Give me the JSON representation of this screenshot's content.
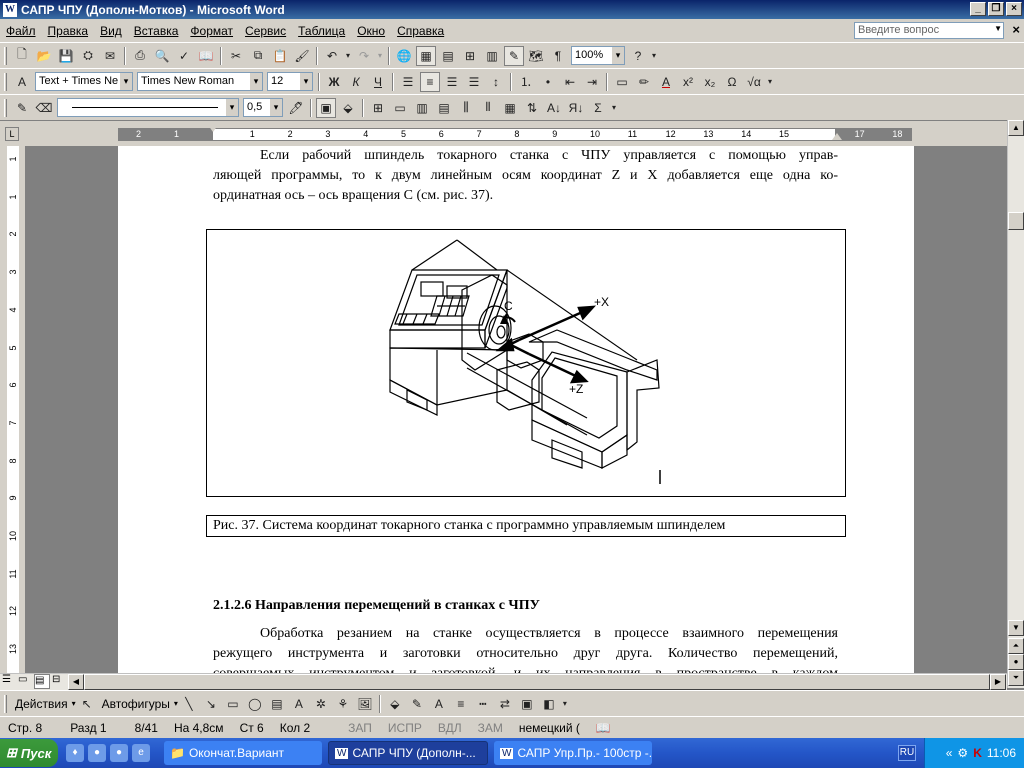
{
  "window": {
    "title": "САПР ЧПУ (Дополн-Мотков) - Microsoft Word",
    "app_icon": "W"
  },
  "menu": {
    "items": [
      "Файл",
      "Правка",
      "Вид",
      "Вставка",
      "Формат",
      "Сервис",
      "Таблица",
      "Окно",
      "Справка"
    ],
    "ask_placeholder": "Введите вопрос"
  },
  "toolbar1": {
    "zoom": "100%"
  },
  "toolbar2": {
    "style": "Text + Times Ne",
    "font": "Times New Roman",
    "size": "12",
    "bold": "Ж",
    "italic": "К",
    "underline": "Ч",
    "omega": "Ω"
  },
  "toolbar3": {
    "line_width": "0,5"
  },
  "ruler": {
    "h_numbers": [
      "2",
      "1",
      "1",
      "2",
      "3",
      "4",
      "5",
      "6",
      "7",
      "8",
      "9",
      "10",
      "11",
      "12",
      "13",
      "14",
      "15",
      "16",
      "17",
      "18"
    ],
    "v_numbers": [
      "1",
      "1",
      "2",
      "3",
      "4",
      "5",
      "6",
      "7",
      "8",
      "9",
      "10",
      "11",
      "12",
      "13",
      "14"
    ]
  },
  "document": {
    "intro_line1": "Если рабочий шпиндель токарного станка с ЧПУ управляется с помощью управ-",
    "intro_line2": "ляющей программы, то к двум линейным осям координат Z и X добавляется еще одна ко-",
    "intro_line3": "ординатная ось – ось вращения С (см. рис. 37).",
    "figure_labels": {
      "c": "C",
      "x": "+X",
      "z": "+Z"
    },
    "caption": "Рис. 37. Система координат токарного станка с программно управляемым шпинделем",
    "heading": "2.1.2.6 Направления перемещений в станках с ЧПУ",
    "body_line1": "Обработка резанием на станке осуществляется в процессе взаимного перемещения",
    "body_line2": "режущего инструмента и заготовки относительно друг друга. Количество перемещений,",
    "body_line3": "совершаемых инструментом и заготовкой, и их направления в пространстве в каждом"
  },
  "drawbar": {
    "actions": "Действия",
    "autoshapes": "Автофигуры"
  },
  "status": {
    "page": "Стр. 8",
    "section": "Разд 1",
    "pages": "8/41",
    "at": "На 4,8см",
    "line": "Ст 6",
    "col": "Кол 2",
    "rec": "ЗАП",
    "trk": "ИСПР",
    "ext": "ВДЛ",
    "ovr": "ЗАМ",
    "lang": "немецкий ("
  },
  "taskbar": {
    "start": "Пуск",
    "tasks": [
      "Окончат.Вариант",
      "САПР ЧПУ (Дополн-...",
      "САПР Упр.Пр.- 100стр -..."
    ],
    "lang": "RU",
    "time": "11:06"
  }
}
